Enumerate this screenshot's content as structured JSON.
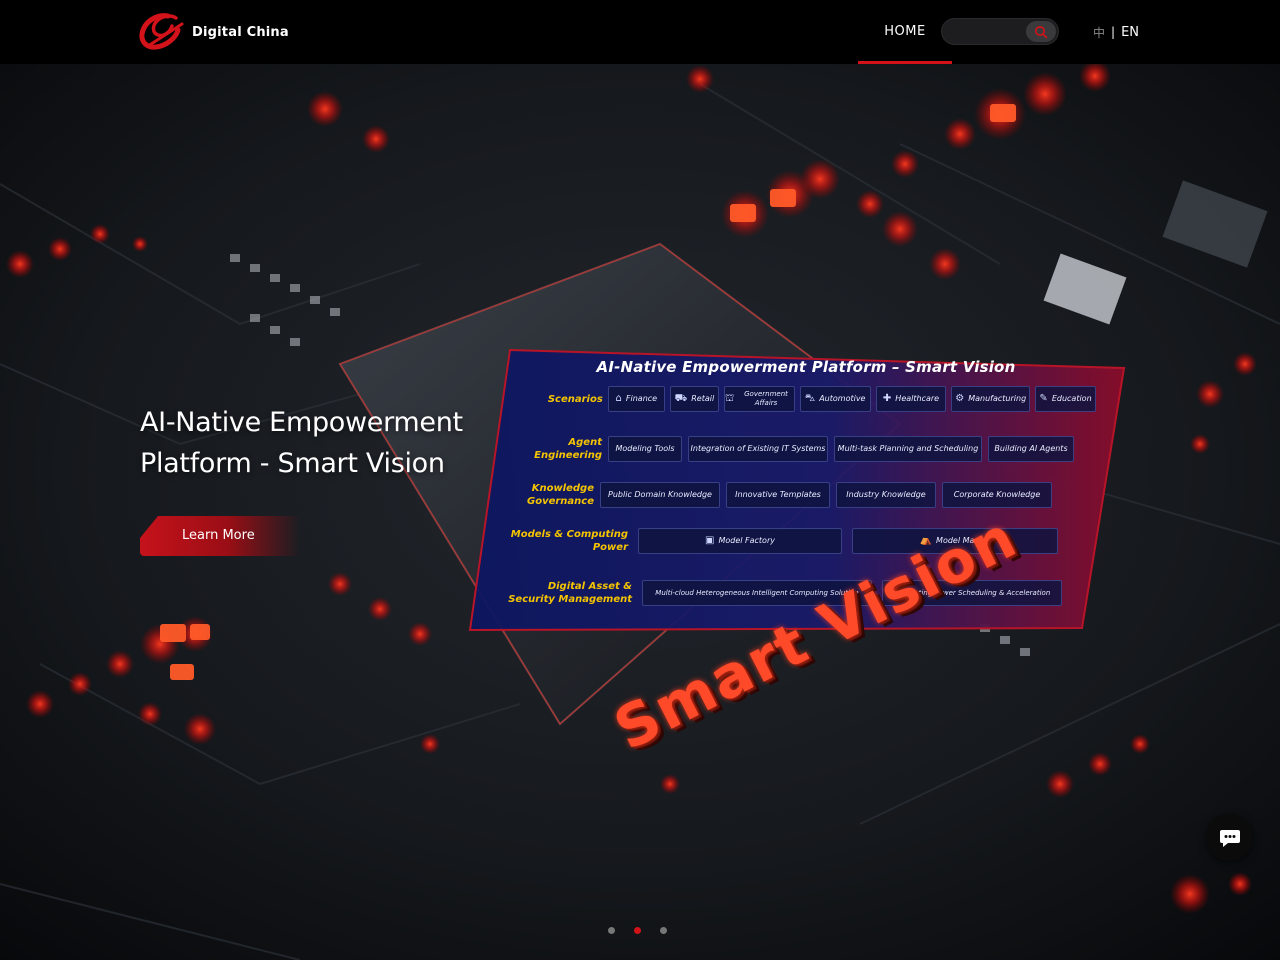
{
  "brand": {
    "name": "Digital China",
    "accent": "#d4121a"
  },
  "nav": {
    "home": "HOME"
  },
  "search": {
    "placeholder": "",
    "icon": "search-icon"
  },
  "lang": {
    "zh": "中",
    "sep": "|",
    "en": "EN"
  },
  "hero": {
    "title": "AI-Native Empowerment Platform - Smart Vision",
    "cta": "Learn More",
    "overlay_text": "Smart Vision"
  },
  "platform": {
    "title": "AI-Native Empowerment Platform – Smart Vision",
    "rows": [
      {
        "label": "Scenarios",
        "cells": [
          {
            "text": "Finance",
            "icon": "bank-icon"
          },
          {
            "text": "Retail",
            "icon": "cart-icon"
          },
          {
            "text": "Government Affairs",
            "icon": "government-icon"
          },
          {
            "text": "Automotive",
            "icon": "car-icon"
          },
          {
            "text": "Healthcare",
            "icon": "medical-icon"
          },
          {
            "text": "Manufacturing",
            "icon": "factory-icon"
          },
          {
            "text": "Education",
            "icon": "education-icon"
          }
        ]
      },
      {
        "label": "Agent Engineering",
        "cells": [
          {
            "text": "Modeling Tools"
          },
          {
            "text": "Integration of Existing IT Systems"
          },
          {
            "text": "Multi-task Planning and Scheduling"
          },
          {
            "text": "Building AI Agents"
          }
        ]
      },
      {
        "label": "Knowledge Governance",
        "cells": [
          {
            "text": "Public Domain Knowledge"
          },
          {
            "text": "Innovative Templates"
          },
          {
            "text": "Industry Knowledge"
          },
          {
            "text": "Corporate Knowledge"
          }
        ]
      },
      {
        "label": "Models & Computing Power",
        "cells": [
          {
            "text": "Model Factory",
            "icon": "factory-box-icon"
          },
          {
            "text": "Model Market",
            "icon": "market-icon"
          }
        ]
      },
      {
        "label": "Digital Asset & Security Management",
        "cells": [
          {
            "text": "Multi-cloud Heterogeneous Intelligent Computing Solution"
          },
          {
            "text": "Computing Power Scheduling & Acceleration"
          }
        ]
      }
    ]
  },
  "carousel": {
    "slides": 3,
    "active": 2
  },
  "chat": {
    "icon": "chat-bubble-icon"
  }
}
